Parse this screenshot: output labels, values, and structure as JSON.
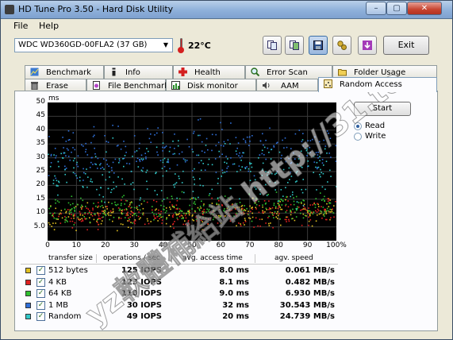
{
  "window": {
    "title": "HD Tune Pro 3.50 - Hard Disk Utility"
  },
  "window_controls": {
    "minimize": "–",
    "maximize": "▢",
    "close": "✕"
  },
  "menu": {
    "file": "File",
    "help": "Help"
  },
  "toolbar": {
    "drive": "WDC  WD360GD-00FLA2 (37 GB)",
    "temperature": "22°C",
    "exit_label": "Exit"
  },
  "tabs_row1": [
    {
      "label": "Benchmark",
      "icon": "benchmark-icon"
    },
    {
      "label": "Info",
      "icon": "info-icon"
    },
    {
      "label": "Health",
      "icon": "health-icon"
    },
    {
      "label": "Error Scan",
      "icon": "magnifier-icon"
    },
    {
      "label": "Folder Usage",
      "icon": "folder-icon"
    }
  ],
  "tabs_row2": [
    {
      "label": "Erase",
      "icon": "trash-icon"
    },
    {
      "label": "File Benchmark",
      "icon": "file-benchmark-icon"
    },
    {
      "label": "Disk monitor",
      "icon": "disk-monitor-icon"
    },
    {
      "label": "AAM",
      "icon": "speaker-icon"
    },
    {
      "label": "Random Access",
      "icon": "random-access-icon",
      "active": true
    }
  ],
  "controls": {
    "start_label": "Start",
    "radio_read": "Read",
    "radio_write": "Write",
    "selected": "Read"
  },
  "chart_data": {
    "type": "scatter",
    "ylabel": "ms",
    "y_ticks": [
      "50",
      "45",
      "40",
      "35",
      "30",
      "25",
      "20",
      "15",
      "10",
      "5.0"
    ],
    "x_ticks": [
      "0",
      "10",
      "20",
      "30",
      "40",
      "50",
      "60",
      "70",
      "80",
      "90",
      "100%"
    ],
    "xlim": [
      0,
      100
    ],
    "ylim": [
      0,
      50
    ],
    "grid": true,
    "series": [
      {
        "name": "512 bytes",
        "color": "#e0c020",
        "avg_access_ms": 8.0,
        "spread": [
          2,
          16
        ]
      },
      {
        "name": "4 KB",
        "color": "#e02020",
        "avg_access_ms": 8.1,
        "spread": [
          2,
          16
        ]
      },
      {
        "name": "64 KB",
        "color": "#30c030",
        "avg_access_ms": 9.0,
        "spread": [
          3,
          18
        ]
      },
      {
        "name": "1 MB",
        "color": "#2f6fd8",
        "avg_access_ms": 32,
        "spread": [
          18,
          45
        ]
      },
      {
        "name": "Random",
        "color": "#30c8c8",
        "avg_access_ms": 20,
        "spread": [
          6,
          42
        ]
      }
    ]
  },
  "results": {
    "headers": [
      "transfer size",
      "operations / sec",
      "avg. access time",
      "agv. speed"
    ],
    "rows": [
      {
        "label": "512 bytes",
        "color": "#e0c020",
        "ops": "125 IOPS",
        "access": "8.0 ms",
        "speed": "0.061 MB/s"
      },
      {
        "label": "4 KB",
        "color": "#e02020",
        "ops": "123 IOPS",
        "access": "8.1 ms",
        "speed": "0.482 MB/s"
      },
      {
        "label": "64 KB",
        "color": "#30c030",
        "ops": "110 IOPS",
        "access": "9.0 ms",
        "speed": "6.930 MB/s"
      },
      {
        "label": "1 MB",
        "color": "#2f6fd8",
        "ops": "30 IOPS",
        "access": "32 ms",
        "speed": "30.543 MB/s"
      },
      {
        "label": "Random",
        "color": "#30c8c8",
        "ops": "49 IOPS",
        "access": "20 ms",
        "speed": "24.739 MB/s"
      }
    ]
  },
  "watermark": "yz軟體補給站 http://31.to"
}
